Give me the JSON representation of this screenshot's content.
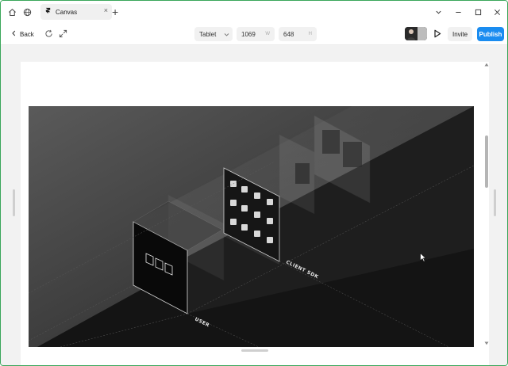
{
  "tabbar": {
    "tab_title": "Canvas",
    "tab_close": "×",
    "tab_add": "+"
  },
  "window_controls": {
    "dropdown": "⌄",
    "minimize": "–",
    "maximize": "□",
    "close": "✕"
  },
  "toolbar": {
    "back_label": "Back",
    "device_select": "Tablet",
    "width_value": "1069",
    "width_suffix": "W",
    "height_value": "648",
    "height_suffix": "H",
    "invite_label": "Invite",
    "publish_label": "Publish"
  },
  "scene": {
    "labels": {
      "user": "USER",
      "client_sdk": "CLIENT SDK"
    }
  },
  "colors": {
    "publish": "#1a8cf0",
    "window_border": "#3aa65a",
    "scene_bg": "#111111"
  }
}
